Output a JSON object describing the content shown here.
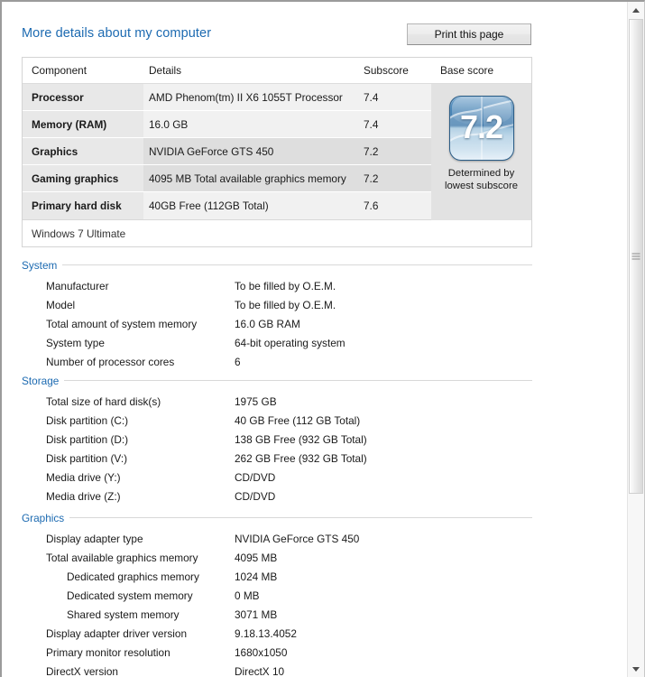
{
  "header": {
    "title": "More details about my computer",
    "print_button": "Print this page"
  },
  "score_table": {
    "columns": [
      "Component",
      "Details",
      "Subscore",
      "Base score"
    ],
    "rows": [
      {
        "component": "Processor",
        "details": "AMD Phenom(tm) II X6 1055T Processor",
        "subscore": "7.4",
        "lowest": false
      },
      {
        "component": "Memory (RAM)",
        "details": "16.0 GB",
        "subscore": "7.4",
        "lowest": false
      },
      {
        "component": "Graphics",
        "details": "NVIDIA GeForce GTS 450",
        "subscore": "7.2",
        "lowest": true
      },
      {
        "component": "Gaming graphics",
        "details": "4095 MB Total available graphics memory",
        "subscore": "7.2",
        "lowest": true
      },
      {
        "component": "Primary hard disk",
        "details": "40GB Free (112GB Total)",
        "subscore": "7.6",
        "lowest": false
      }
    ],
    "footer": "Windows 7 Ultimate",
    "base_score": {
      "value": "7.2",
      "caption_line1": "Determined by",
      "caption_line2": "lowest subscore",
      "badge_color": "#3f79ab",
      "accent_color": "#1c6ab1"
    }
  },
  "sections": [
    {
      "title": "System",
      "rows": [
        {
          "label": "Manufacturer",
          "value": "To be filled by O.E.M.",
          "indent": false
        },
        {
          "label": "Model",
          "value": "To be filled by O.E.M.",
          "indent": false
        },
        {
          "label": "Total amount of system memory",
          "value": "16.0 GB RAM",
          "indent": false
        },
        {
          "label": "System type",
          "value": "64-bit operating system",
          "indent": false
        },
        {
          "label": "Number of processor cores",
          "value": "6",
          "indent": false
        }
      ]
    },
    {
      "title": "Storage",
      "rows": [
        {
          "label": "Total size of hard disk(s)",
          "value": "1975 GB",
          "indent": false
        },
        {
          "label": "Disk partition (C:)",
          "value": "40 GB Free (112 GB Total)",
          "indent": false
        },
        {
          "label": "Disk partition (D:)",
          "value": "138 GB Free (932 GB Total)",
          "indent": false
        },
        {
          "label": "Disk partition (V:)",
          "value": "262 GB Free (932 GB Total)",
          "indent": false
        },
        {
          "label": "Media drive (Y:)",
          "value": "CD/DVD",
          "indent": false
        },
        {
          "label": "Media drive (Z:)",
          "value": "CD/DVD",
          "indent": false
        }
      ]
    },
    {
      "title": "Graphics",
      "rows": [
        {
          "label": "Display adapter type",
          "value": "NVIDIA GeForce GTS 450",
          "indent": false
        },
        {
          "label": "Total available graphics memory",
          "value": "4095 MB",
          "indent": false
        },
        {
          "label": "Dedicated graphics memory",
          "value": "1024 MB",
          "indent": true
        },
        {
          "label": "Dedicated system memory",
          "value": "0 MB",
          "indent": true
        },
        {
          "label": "Shared system memory",
          "value": "3071 MB",
          "indent": true
        },
        {
          "label": "Display adapter driver version",
          "value": "9.18.13.4052",
          "indent": false
        },
        {
          "label": "Primary monitor resolution",
          "value": "1680x1050",
          "indent": false
        },
        {
          "label": "DirectX version",
          "value": "DirectX 10",
          "indent": false
        }
      ]
    }
  ],
  "scrollbar": {
    "up_arrow": "scroll-up-arrow",
    "down_arrow": "scroll-down-arrow"
  }
}
